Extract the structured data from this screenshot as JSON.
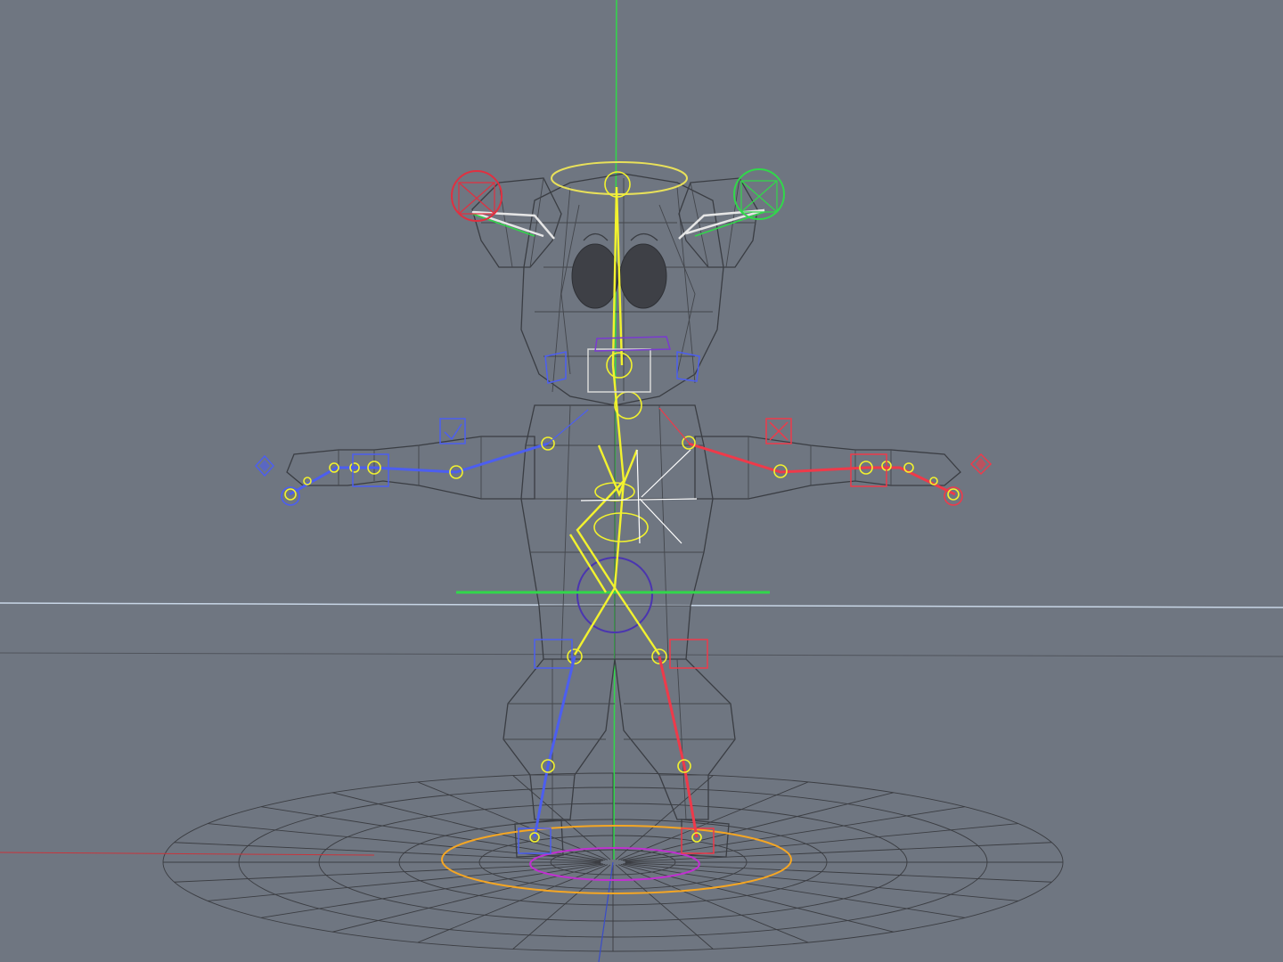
{
  "viewport": {
    "view": "perspective",
    "display_mode": "wireframe",
    "background_color": "#6f7681"
  },
  "colors": {
    "mesh_wire": "#3a3d43",
    "spine_bones": "#f2f22e",
    "right_side_bones": "#4c5ef0",
    "left_side_bones": "#ee3a4a",
    "axis_vertical": "#31d84a",
    "axis_horizon": "#c8d6e6",
    "root_circle": "#f5a623",
    "cog_circle": "#c030d0",
    "head_control": "#e8e05a"
  },
  "icons": [
    "ik-box-left-icon",
    "ik-box-right-icon",
    "wrist-control-left-icon",
    "wrist-control-right-icon",
    "ear-control-left-icon",
    "ear-control-right-icon"
  ]
}
